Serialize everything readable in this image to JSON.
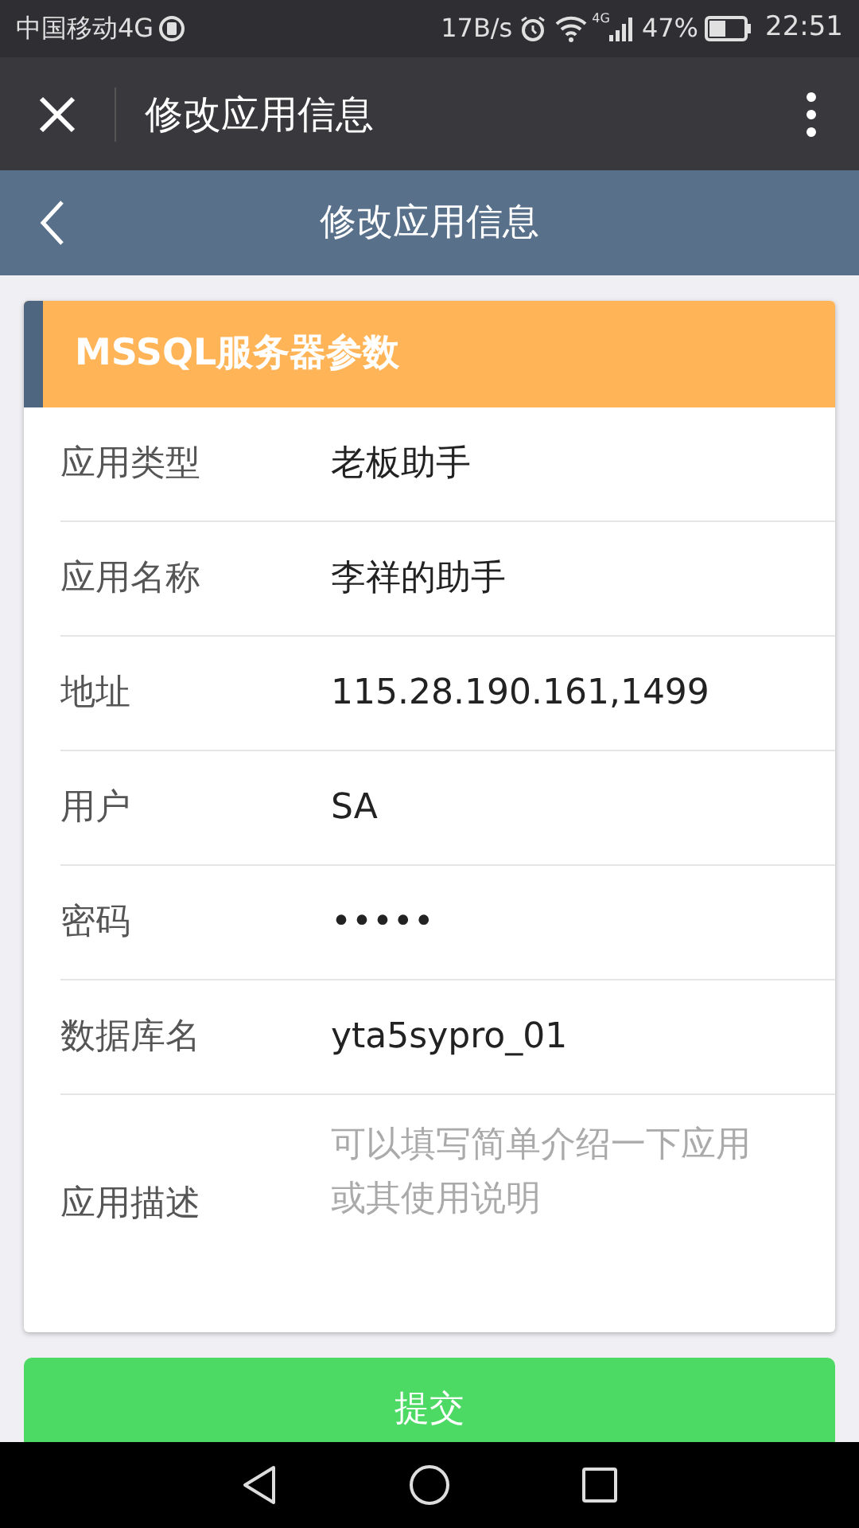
{
  "status_bar": {
    "carrier": "中国移动4G",
    "speed": "17B/s",
    "network": "4G",
    "battery": "47%",
    "time": "22:51"
  },
  "title_bar": {
    "title": "修改应用信息"
  },
  "nav_bar": {
    "title": "修改应用信息"
  },
  "section": {
    "title": "MSSQL服务器参数"
  },
  "fields": [
    {
      "kind": "text",
      "label": "应用类型",
      "value": "老板助手"
    },
    {
      "kind": "text",
      "label": "应用名称",
      "value": "李祥的助手"
    },
    {
      "kind": "text",
      "label": "地址",
      "value": "115.28.190.161,1499"
    },
    {
      "kind": "text",
      "label": "用户",
      "value": "SA"
    },
    {
      "kind": "text",
      "label": "密码",
      "value": "•••••"
    },
    {
      "kind": "text",
      "label": "数据库名",
      "value": "yta5sypro_01"
    },
    {
      "kind": "textarea",
      "label": "应用描述",
      "placeholder": "可以填写简单介绍一下应用或其使用说明"
    }
  ],
  "submit_button": "提交"
}
